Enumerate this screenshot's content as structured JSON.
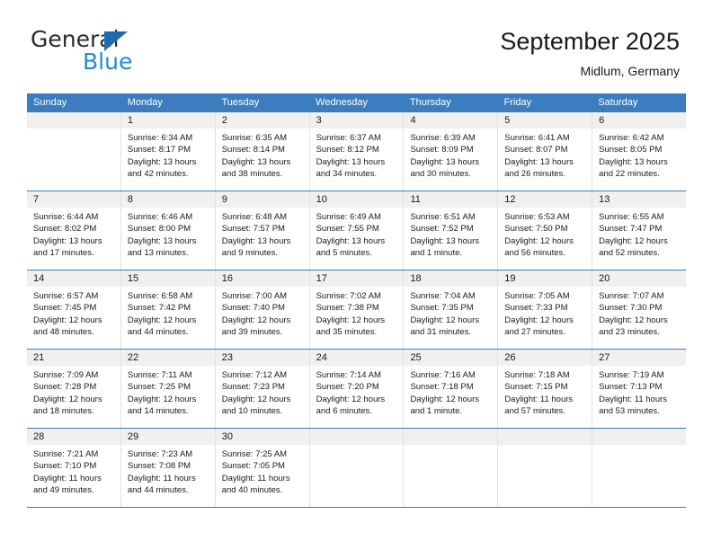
{
  "brand": {
    "name_top": "General",
    "name_bottom": "Blue",
    "triangle_color": "#1d6cb0",
    "blue_text_color": "#2389d4"
  },
  "header": {
    "title": "September 2025",
    "location": "Midlum, Germany"
  },
  "theme": {
    "header_blue": "#3b7dbf",
    "daynum_strip": "#f0f0f0",
    "cell_border": "#e2e2e2"
  },
  "weekdays": [
    "Sunday",
    "Monday",
    "Tuesday",
    "Wednesday",
    "Thursday",
    "Friday",
    "Saturday"
  ],
  "weeks": [
    [
      {
        "day": "",
        "sunrise": "",
        "sunset": "",
        "daylight_1": "",
        "daylight_2": ""
      },
      {
        "day": "1",
        "sunrise": "Sunrise: 6:34 AM",
        "sunset": "Sunset: 8:17 PM",
        "daylight_1": "Daylight: 13 hours",
        "daylight_2": "and 42 minutes."
      },
      {
        "day": "2",
        "sunrise": "Sunrise: 6:35 AM",
        "sunset": "Sunset: 8:14 PM",
        "daylight_1": "Daylight: 13 hours",
        "daylight_2": "and 38 minutes."
      },
      {
        "day": "3",
        "sunrise": "Sunrise: 6:37 AM",
        "sunset": "Sunset: 8:12 PM",
        "daylight_1": "Daylight: 13 hours",
        "daylight_2": "and 34 minutes."
      },
      {
        "day": "4",
        "sunrise": "Sunrise: 6:39 AM",
        "sunset": "Sunset: 8:09 PM",
        "daylight_1": "Daylight: 13 hours",
        "daylight_2": "and 30 minutes."
      },
      {
        "day": "5",
        "sunrise": "Sunrise: 6:41 AM",
        "sunset": "Sunset: 8:07 PM",
        "daylight_1": "Daylight: 13 hours",
        "daylight_2": "and 26 minutes."
      },
      {
        "day": "6",
        "sunrise": "Sunrise: 6:42 AM",
        "sunset": "Sunset: 8:05 PM",
        "daylight_1": "Daylight: 13 hours",
        "daylight_2": "and 22 minutes."
      }
    ],
    [
      {
        "day": "7",
        "sunrise": "Sunrise: 6:44 AM",
        "sunset": "Sunset: 8:02 PM",
        "daylight_1": "Daylight: 13 hours",
        "daylight_2": "and 17 minutes."
      },
      {
        "day": "8",
        "sunrise": "Sunrise: 6:46 AM",
        "sunset": "Sunset: 8:00 PM",
        "daylight_1": "Daylight: 13 hours",
        "daylight_2": "and 13 minutes."
      },
      {
        "day": "9",
        "sunrise": "Sunrise: 6:48 AM",
        "sunset": "Sunset: 7:57 PM",
        "daylight_1": "Daylight: 13 hours",
        "daylight_2": "and 9 minutes."
      },
      {
        "day": "10",
        "sunrise": "Sunrise: 6:49 AM",
        "sunset": "Sunset: 7:55 PM",
        "daylight_1": "Daylight: 13 hours",
        "daylight_2": "and 5 minutes."
      },
      {
        "day": "11",
        "sunrise": "Sunrise: 6:51 AM",
        "sunset": "Sunset: 7:52 PM",
        "daylight_1": "Daylight: 13 hours",
        "daylight_2": "and 1 minute."
      },
      {
        "day": "12",
        "sunrise": "Sunrise: 6:53 AM",
        "sunset": "Sunset: 7:50 PM",
        "daylight_1": "Daylight: 12 hours",
        "daylight_2": "and 56 minutes."
      },
      {
        "day": "13",
        "sunrise": "Sunrise: 6:55 AM",
        "sunset": "Sunset: 7:47 PM",
        "daylight_1": "Daylight: 12 hours",
        "daylight_2": "and 52 minutes."
      }
    ],
    [
      {
        "day": "14",
        "sunrise": "Sunrise: 6:57 AM",
        "sunset": "Sunset: 7:45 PM",
        "daylight_1": "Daylight: 12 hours",
        "daylight_2": "and 48 minutes."
      },
      {
        "day": "15",
        "sunrise": "Sunrise: 6:58 AM",
        "sunset": "Sunset: 7:42 PM",
        "daylight_1": "Daylight: 12 hours",
        "daylight_2": "and 44 minutes."
      },
      {
        "day": "16",
        "sunrise": "Sunrise: 7:00 AM",
        "sunset": "Sunset: 7:40 PM",
        "daylight_1": "Daylight: 12 hours",
        "daylight_2": "and 39 minutes."
      },
      {
        "day": "17",
        "sunrise": "Sunrise: 7:02 AM",
        "sunset": "Sunset: 7:38 PM",
        "daylight_1": "Daylight: 12 hours",
        "daylight_2": "and 35 minutes."
      },
      {
        "day": "18",
        "sunrise": "Sunrise: 7:04 AM",
        "sunset": "Sunset: 7:35 PM",
        "daylight_1": "Daylight: 12 hours",
        "daylight_2": "and 31 minutes."
      },
      {
        "day": "19",
        "sunrise": "Sunrise: 7:05 AM",
        "sunset": "Sunset: 7:33 PM",
        "daylight_1": "Daylight: 12 hours",
        "daylight_2": "and 27 minutes."
      },
      {
        "day": "20",
        "sunrise": "Sunrise: 7:07 AM",
        "sunset": "Sunset: 7:30 PM",
        "daylight_1": "Daylight: 12 hours",
        "daylight_2": "and 23 minutes."
      }
    ],
    [
      {
        "day": "21",
        "sunrise": "Sunrise: 7:09 AM",
        "sunset": "Sunset: 7:28 PM",
        "daylight_1": "Daylight: 12 hours",
        "daylight_2": "and 18 minutes."
      },
      {
        "day": "22",
        "sunrise": "Sunrise: 7:11 AM",
        "sunset": "Sunset: 7:25 PM",
        "daylight_1": "Daylight: 12 hours",
        "daylight_2": "and 14 minutes."
      },
      {
        "day": "23",
        "sunrise": "Sunrise: 7:12 AM",
        "sunset": "Sunset: 7:23 PM",
        "daylight_1": "Daylight: 12 hours",
        "daylight_2": "and 10 minutes."
      },
      {
        "day": "24",
        "sunrise": "Sunrise: 7:14 AM",
        "sunset": "Sunset: 7:20 PM",
        "daylight_1": "Daylight: 12 hours",
        "daylight_2": "and 6 minutes."
      },
      {
        "day": "25",
        "sunrise": "Sunrise: 7:16 AM",
        "sunset": "Sunset: 7:18 PM",
        "daylight_1": "Daylight: 12 hours",
        "daylight_2": "and 1 minute."
      },
      {
        "day": "26",
        "sunrise": "Sunrise: 7:18 AM",
        "sunset": "Sunset: 7:15 PM",
        "daylight_1": "Daylight: 11 hours",
        "daylight_2": "and 57 minutes."
      },
      {
        "day": "27",
        "sunrise": "Sunrise: 7:19 AM",
        "sunset": "Sunset: 7:13 PM",
        "daylight_1": "Daylight: 11 hours",
        "daylight_2": "and 53 minutes."
      }
    ],
    [
      {
        "day": "28",
        "sunrise": "Sunrise: 7:21 AM",
        "sunset": "Sunset: 7:10 PM",
        "daylight_1": "Daylight: 11 hours",
        "daylight_2": "and 49 minutes."
      },
      {
        "day": "29",
        "sunrise": "Sunrise: 7:23 AM",
        "sunset": "Sunset: 7:08 PM",
        "daylight_1": "Daylight: 11 hours",
        "daylight_2": "and 44 minutes."
      },
      {
        "day": "30",
        "sunrise": "Sunrise: 7:25 AM",
        "sunset": "Sunset: 7:05 PM",
        "daylight_1": "Daylight: 11 hours",
        "daylight_2": "and 40 minutes."
      },
      {
        "day": "",
        "sunrise": "",
        "sunset": "",
        "daylight_1": "",
        "daylight_2": ""
      },
      {
        "day": "",
        "sunrise": "",
        "sunset": "",
        "daylight_1": "",
        "daylight_2": ""
      },
      {
        "day": "",
        "sunrise": "",
        "sunset": "",
        "daylight_1": "",
        "daylight_2": ""
      },
      {
        "day": "",
        "sunrise": "",
        "sunset": "",
        "daylight_1": "",
        "daylight_2": ""
      }
    ]
  ]
}
